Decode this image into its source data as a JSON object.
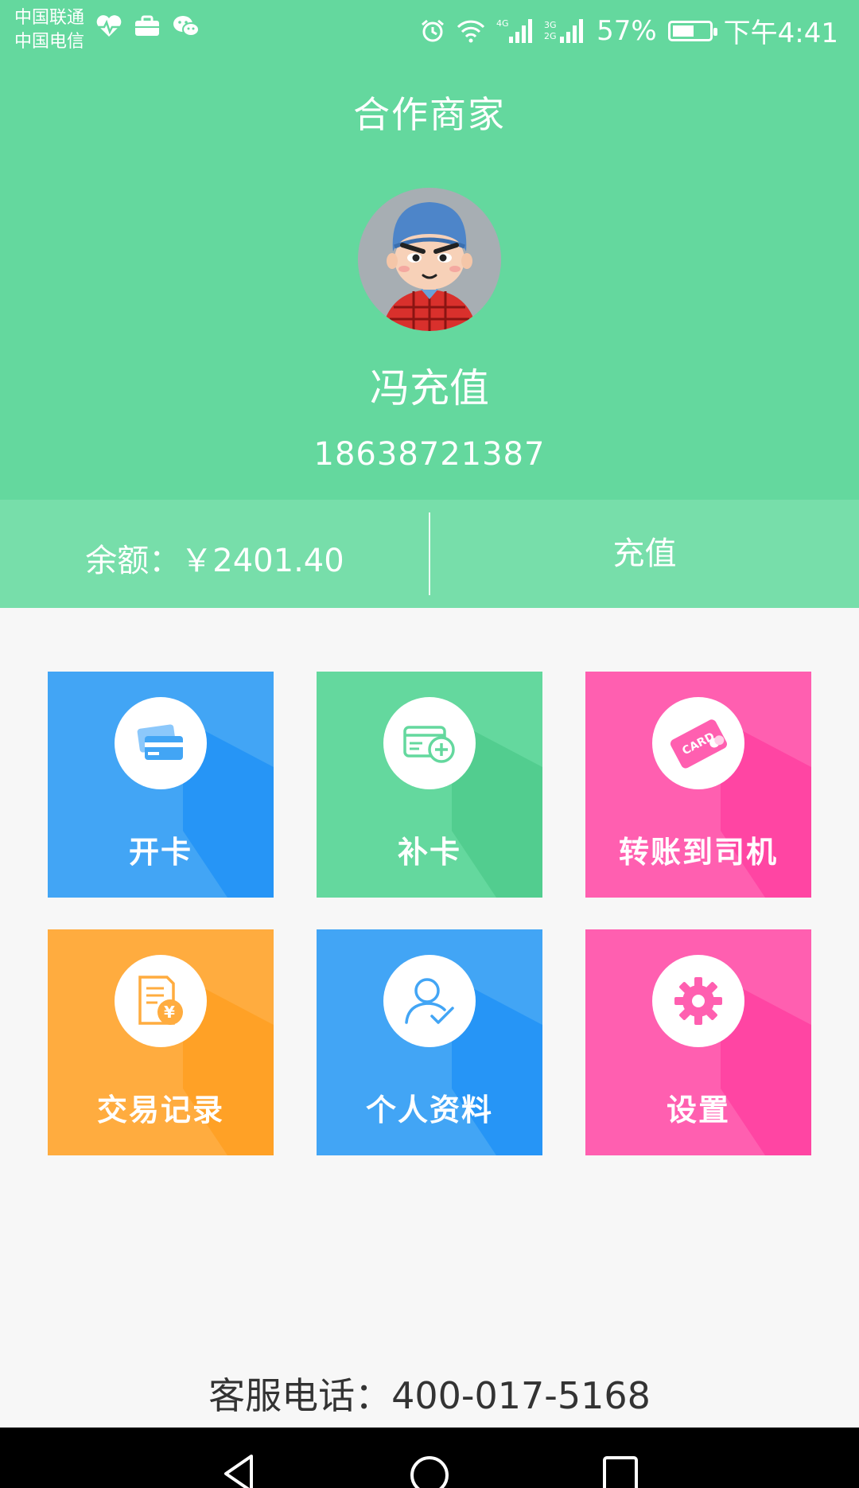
{
  "status_bar": {
    "carrier_1": "中国联通",
    "carrier_2": "中国电信",
    "battery": "57%",
    "time": "下午4:41"
  },
  "header": {
    "title": "合作商家",
    "user_name": "冯充值",
    "phone": "18638721387"
  },
  "balance": {
    "text": "余额：￥2401.40",
    "recharge_label": "充值"
  },
  "tiles": [
    {
      "label": "开卡",
      "icon": "cards-icon",
      "color": "#42a5f5"
    },
    {
      "label": "补卡",
      "icon": "card-add-icon",
      "color": "#64d89e"
    },
    {
      "label": "转账到司机",
      "icon": "card-transfer-icon",
      "color": "#ff5fb0"
    },
    {
      "label": "交易记录",
      "icon": "receipt-yuan-icon",
      "color": "#ffac3f"
    },
    {
      "label": "个人资料",
      "icon": "user-check-icon",
      "color": "#42a5f5"
    },
    {
      "label": "设置",
      "icon": "gear-icon",
      "color": "#ff5fb0"
    }
  ],
  "service_phone": "客服电话：400-017-5168",
  "colors": {
    "header_green": "#64d89e",
    "balance_green": "#77deaa",
    "blue": "#42a5f5",
    "pink": "#ff5fb0",
    "orange": "#ffac3f"
  }
}
